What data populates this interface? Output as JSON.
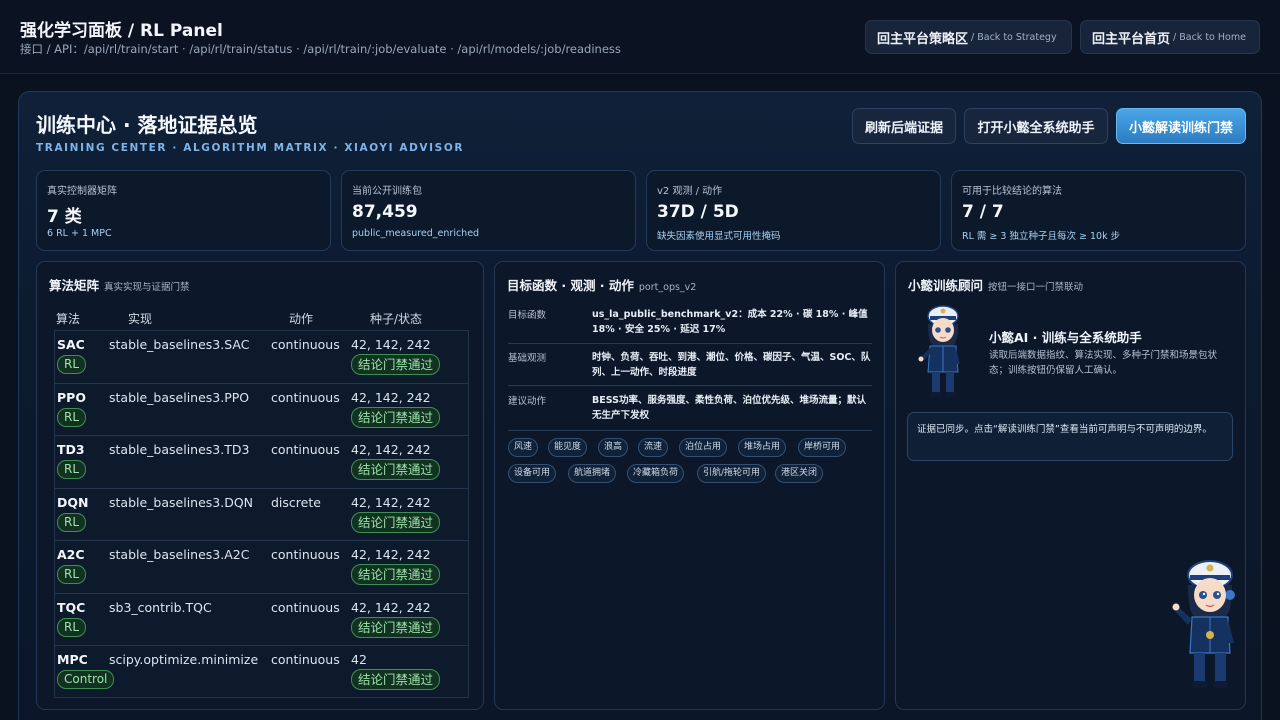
{
  "header": {
    "title": "强化学习面板 / RL Panel",
    "api": "接口 / API：/api/rl/train/start · /api/rl/train/status · /api/rl/train/:job/evaluate · /api/rl/models/:job/readiness",
    "buttons": {
      "strategy": {
        "label": "回主平台策略区",
        "sub": "/ Back to Strategy"
      },
      "home": {
        "label": "回主平台首页",
        "sub": "/ Back to Home"
      }
    }
  },
  "main": {
    "title": "训练中心 · 落地证据总览",
    "subtitle": "TRAINING CENTER · ALGORITHM MATRIX · XIAOYI ADVISOR",
    "actions": {
      "refresh": "刷新后端证据",
      "open": "打开小懿全系统助手",
      "interpret": "小懿解读训练门禁"
    }
  },
  "stats": [
    {
      "label": "真实控制器矩阵",
      "value": "7 类",
      "note": "6 RL + 1 MPC"
    },
    {
      "label": "当前公开训练包",
      "value": "87,459",
      "note": "public_measured_enriched"
    },
    {
      "label": "v2 观测 / 动作",
      "value": "37D / 5D",
      "note": "缺失因素使用显式可用性掩码"
    },
    {
      "label": "可用于比较结论的算法",
      "value": "7 / 7",
      "note": "RL 需 ≥ 3 独立种子且每次 ≥ 10k 步"
    }
  ],
  "algo": {
    "title": "算法矩阵",
    "subtitle": "真实实现与证据门禁",
    "columns": [
      "算法",
      "实现",
      "动作",
      "种子/状态"
    ],
    "rows": [
      {
        "name": "SAC",
        "kind": "RL",
        "impl": "stable_baselines3.SAC",
        "action": "continuous",
        "seeds": "42, 142, 242",
        "status": "结论门禁通过"
      },
      {
        "name": "PPO",
        "kind": "RL",
        "impl": "stable_baselines3.PPO",
        "action": "continuous",
        "seeds": "42, 142, 242",
        "status": "结论门禁通过"
      },
      {
        "name": "TD3",
        "kind": "RL",
        "impl": "stable_baselines3.TD3",
        "action": "continuous",
        "seeds": "42, 142, 242",
        "status": "结论门禁通过"
      },
      {
        "name": "DQN",
        "kind": "RL",
        "impl": "stable_baselines3.DQN",
        "action": "discrete",
        "seeds": "42, 142, 242",
        "status": "结论门禁通过"
      },
      {
        "name": "A2C",
        "kind": "RL",
        "impl": "stable_baselines3.A2C",
        "action": "continuous",
        "seeds": "42, 142, 242",
        "status": "结论门禁通过"
      },
      {
        "name": "TQC",
        "kind": "RL",
        "impl": "sb3_contrib.TQC",
        "action": "continuous",
        "seeds": "42, 142, 242",
        "status": "结论门禁通过"
      },
      {
        "name": "MPC",
        "kind": "Control",
        "impl": "scipy.optimize.minimize",
        "action": "continuous",
        "seeds": "42",
        "status": "结论门禁通过"
      }
    ]
  },
  "objective": {
    "title": "目标函数 · 观测 · 动作",
    "tag": "port_ops_v2",
    "rows": [
      {
        "key": "目标函数",
        "value": "us_la_public_benchmark_v2：成本 22% · 碳 18% · 峰值 18% · 安全 25% · 延迟 17%"
      },
      {
        "key": "基础观测",
        "value": "时钟、负荷、吞吐、到港、潮位、价格、碳因子、气温、SOC、队列、上一动作、时段进度"
      },
      {
        "key": "建议动作",
        "value": "BESS功率、服务强度、柔性负荷、泊位优先级、堆场流量；默认无生产下发权"
      }
    ],
    "chips": [
      "风速",
      "能见度",
      "浪高",
      "流速",
      "泊位占用",
      "堆场占用",
      "岸桥可用",
      "设备可用",
      "航道拥堵",
      "冷藏箱负荷",
      "引航/拖轮可用",
      "港区关闭"
    ]
  },
  "advisor": {
    "title": "小懿训练顾问",
    "subtitle": "按钮一接口一门禁联动",
    "name": "小懿AI · 训练与全系统助手",
    "desc": "读取后端数据指纹、算法实现、多种子门禁和场景包状态；训练按钮仍保留人工确认。",
    "message": "证据已同步。点击“解读训练门禁”查看当前可声明与不可声明的边界。"
  }
}
